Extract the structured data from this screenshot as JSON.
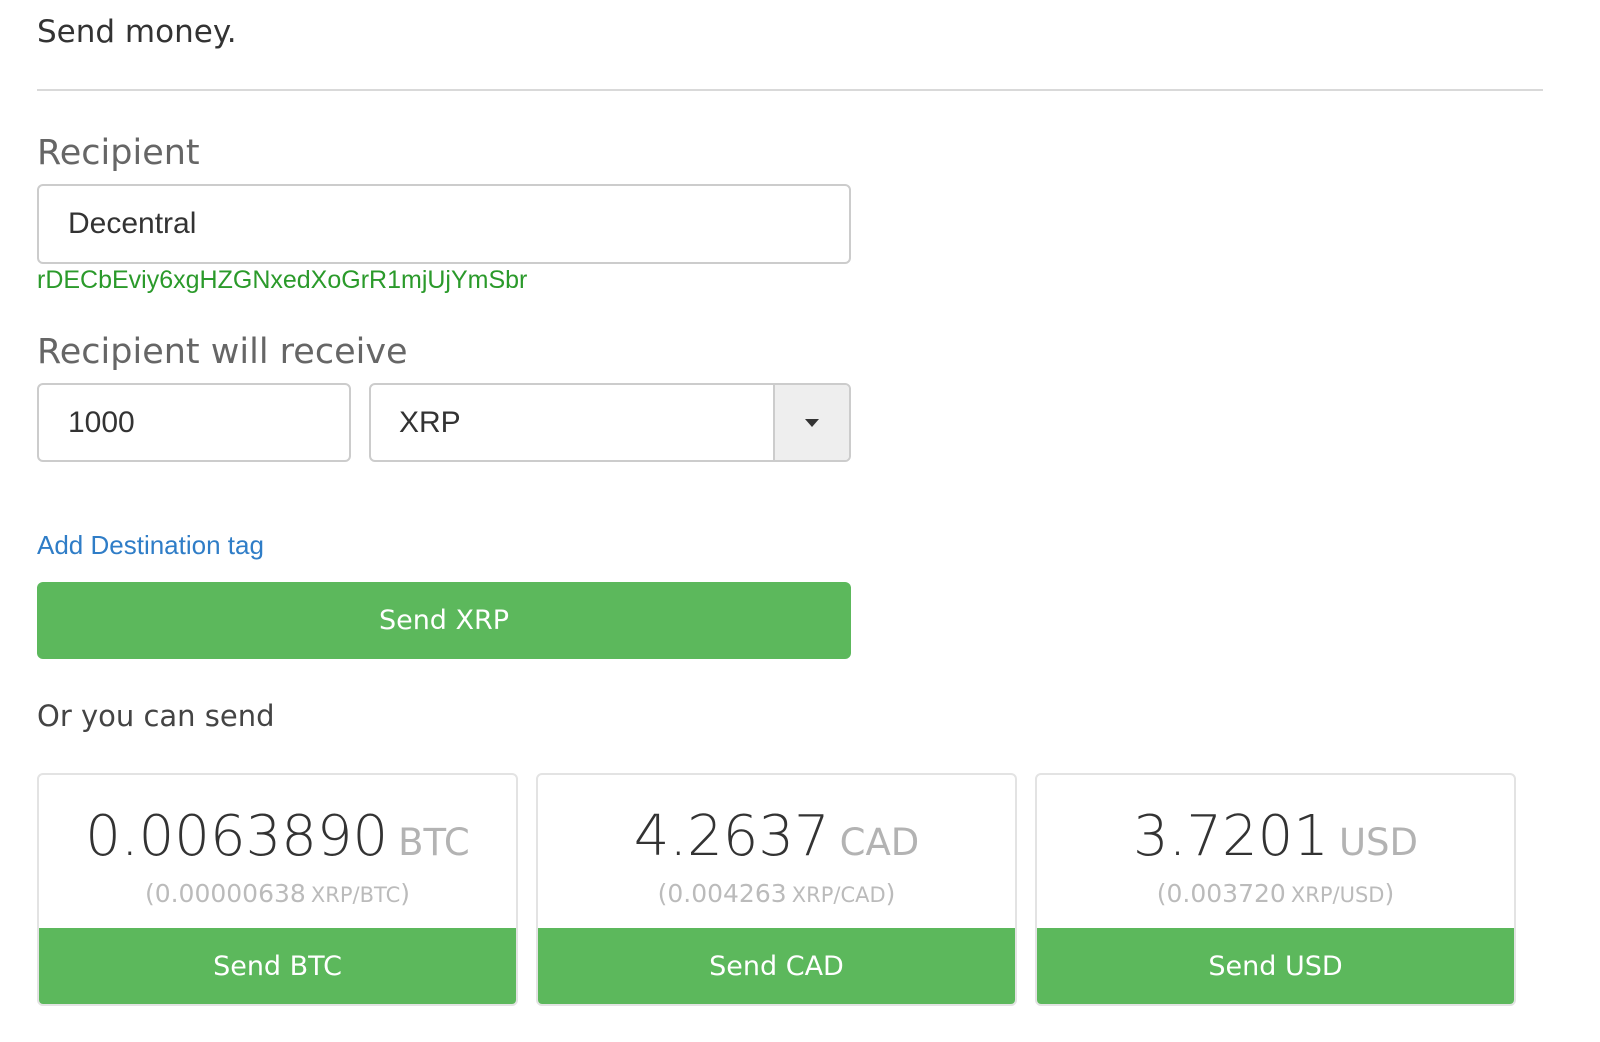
{
  "page_title": "Send money.",
  "recipient": {
    "label": "Recipient",
    "value": "Decentral",
    "resolved_address": "rDECbEviy6xgHZGNxedXoGrR1mjUjYmSbr"
  },
  "receive": {
    "label": "Recipient will receive",
    "amount": "1000",
    "currency": "XRP"
  },
  "add_destination_tag": "Add Destination tag",
  "send_button": "Send XRP",
  "alternatives_title": "Or you can send",
  "alternatives": [
    {
      "amount": "0.0063890",
      "currency": "BTC",
      "rate_open": "(",
      "rate": "0.00000638",
      "rate_unit": "XRP/BTC",
      "rate_close": ")",
      "button": "Send BTC"
    },
    {
      "amount": "4.2637",
      "currency": "CAD",
      "rate_open": "(",
      "rate": "0.004263",
      "rate_unit": "XRP/CAD",
      "rate_close": ")",
      "button": "Send CAD"
    },
    {
      "amount": "3.7201",
      "currency": "USD",
      "rate_open": "(",
      "rate": "0.003720",
      "rate_unit": "XRP/USD",
      "rate_close": ")",
      "button": "Send USD"
    }
  ],
  "colors": {
    "primary_button": "#5cb85c",
    "link": "#2f7dc7",
    "address_valid": "#2b9a2b"
  },
  "icons": {
    "currency_dropdown": "caret-down-icon"
  }
}
